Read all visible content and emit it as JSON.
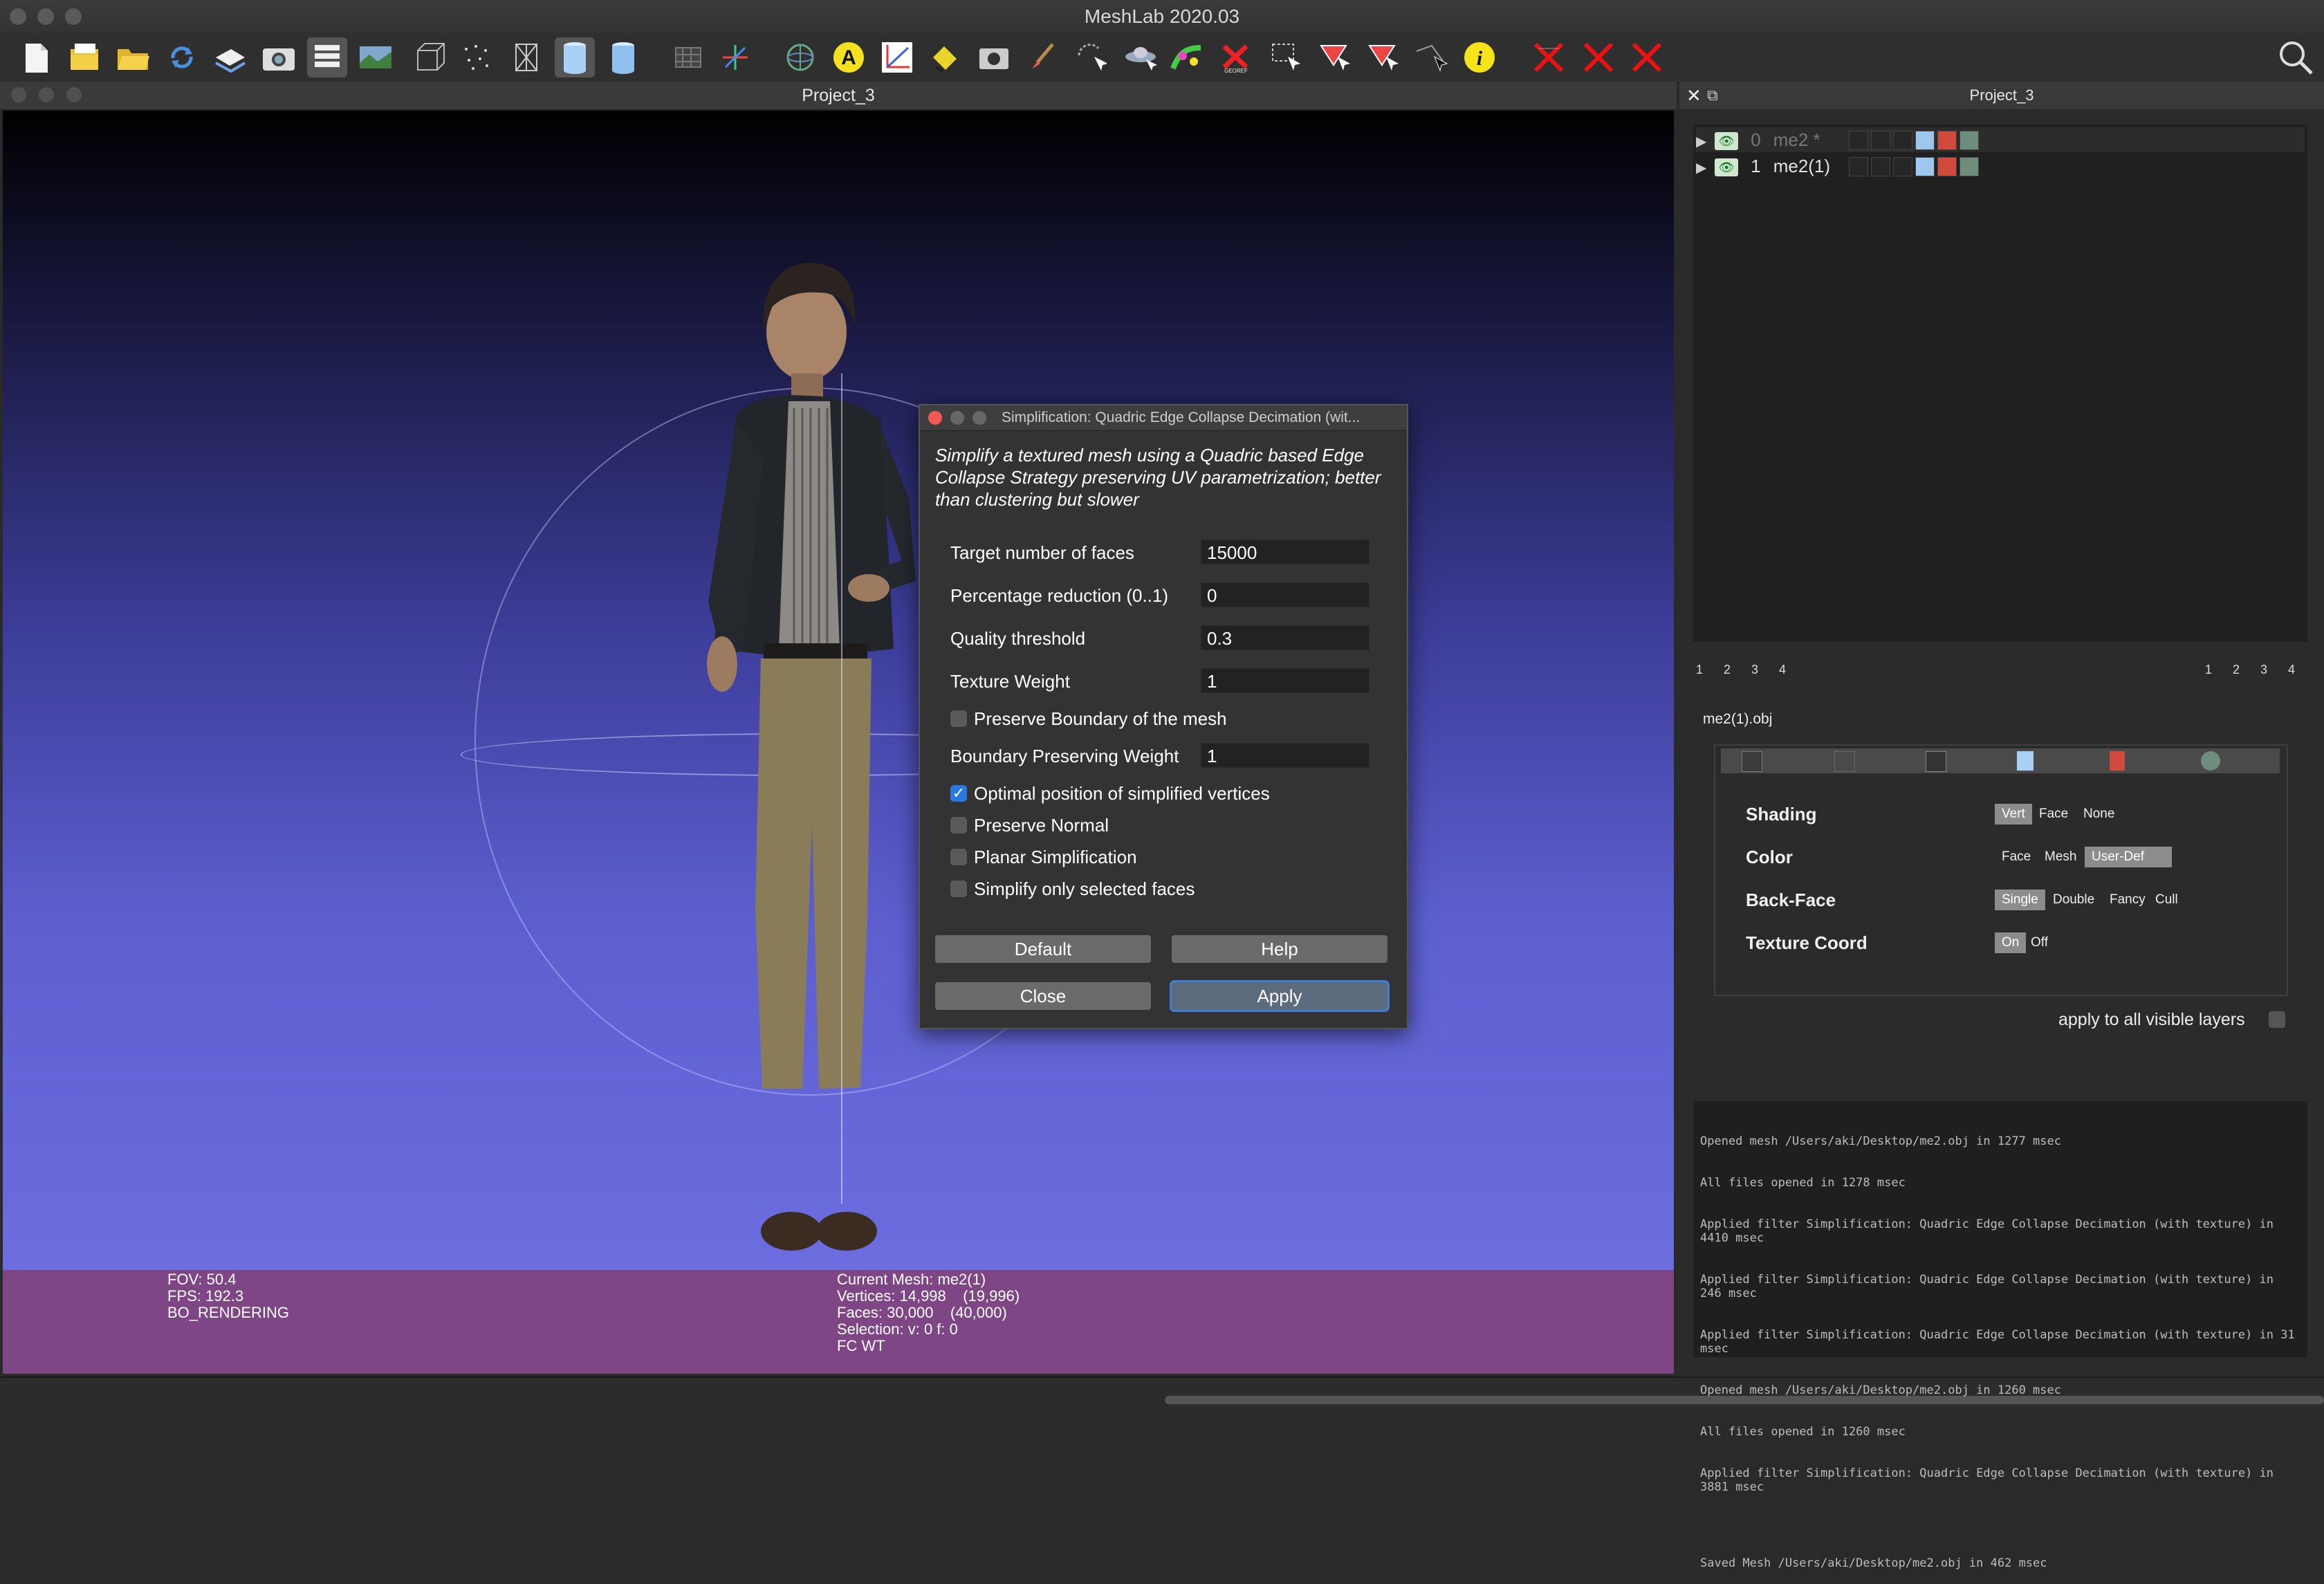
{
  "window": {
    "title": "MeshLab 2020.03"
  },
  "toolbar": {
    "icons": [
      "new-file",
      "open-project",
      "open-folder",
      "reload",
      "layer-import",
      "snapshot",
      "layers-toggle",
      "raster",
      "bbox",
      "points",
      "wireframe",
      "solid",
      "smooth",
      "texture-grid",
      "axis",
      "trackball",
      "text-annotation",
      "measure",
      "paint-bucket",
      "camera",
      "brush",
      "select-points",
      "ufo",
      "ramp",
      "remove",
      "select-faces",
      "select-connected",
      "select-vertices",
      "select-area",
      "info",
      "delete-faces",
      "delete-vertices",
      "delete-edges"
    ],
    "search_icon": "search-icon"
  },
  "viewport": {
    "title": "Project_3",
    "info_left": [
      "FOV: 50.4",
      "FPS:   192.3",
      "BO_RENDERING"
    ],
    "info_center": [
      "Current Mesh: me2(1)",
      "Vertices: 14,998    (19,996)",
      "Faces: 30,000    (40,000)",
      "Selection: v: 0 f: 0",
      "FC WT"
    ]
  },
  "dialog": {
    "title": "Simplification: Quadric Edge Collapse Decimation (wit...",
    "description": "Simplify a textured mesh using a Quadric based Edge Collapse Strategy preserving UV parametrization; better than clustering but slower",
    "fields": [
      {
        "label": "Target number of faces",
        "value": "15000"
      },
      {
        "label": "Percentage reduction (0..1)",
        "value": "0"
      },
      {
        "label": "Quality threshold",
        "value": "0.3"
      },
      {
        "label": "Texture Weight",
        "value": "1"
      }
    ],
    "preserve_boundary": {
      "label": "Preserve Boundary of the mesh",
      "checked": false
    },
    "boundary_weight": {
      "label": "Boundary Preserving Weight",
      "value": "1"
    },
    "checkboxes": [
      {
        "label": "Optimal position of simplified vertices",
        "checked": true
      },
      {
        "label": "Preserve Normal",
        "checked": false
      },
      {
        "label": "Planar Simplification",
        "checked": false
      },
      {
        "label": "Simplify only selected faces",
        "checked": false
      }
    ],
    "buttons": {
      "default": "Default",
      "help": "Help",
      "close": "Close",
      "apply": "Apply"
    }
  },
  "right_panel": {
    "title": "Project_3",
    "layers": [
      {
        "index": "0",
        "name": "me2 *",
        "visible": true
      },
      {
        "index": "1",
        "name": "me2(1)",
        "visible": true
      }
    ],
    "numbers_left": [
      "1",
      "2",
      "3",
      "4"
    ],
    "numbers_right": [
      "1",
      "2",
      "3",
      "4"
    ],
    "mesh_file": "me2(1).obj",
    "decorators": [
      {
        "label": "Shading",
        "options": [
          "Vert",
          "Face",
          "None"
        ],
        "selected": "Vert"
      },
      {
        "label": "Color",
        "options": [
          "Face",
          "Mesh",
          "User-Def"
        ],
        "selected": "User-Def"
      },
      {
        "label": "Back-Face",
        "options": [
          "Single",
          "Double",
          "Fancy",
          "Cull"
        ],
        "selected": "Single"
      },
      {
        "label": "Texture Coord",
        "options": [
          "On",
          "Off"
        ],
        "selected": "On"
      }
    ],
    "apply_all": "apply to all visible layers"
  },
  "log": [
    "Opened mesh /Users/aki/Desktop/me2.obj in 1277 msec",
    "All files opened in 1278 msec",
    "Applied filter Simplification: Quadric Edge Collapse Decimation (with texture) in 4410 msec",
    "Applied filter Simplification: Quadric Edge Collapse Decimation (with texture) in 246 msec",
    "Applied filter Simplification: Quadric Edge Collapse Decimation (with texture) in 31 msec",
    "Opened mesh /Users/aki/Desktop/me2.obj in 1260 msec",
    "All files opened in 1260 msec",
    "Applied filter Simplification: Quadric Edge Collapse Decimation (with texture) in 3881 msec",
    "",
    "Saved Mesh /Users/aki/Desktop/me2.obj in 462 msec"
  ],
  "colors": {
    "accent": "#2a78e0",
    "infobar": "#7f4685",
    "viewport_bottom": "#6c6ddf"
  }
}
